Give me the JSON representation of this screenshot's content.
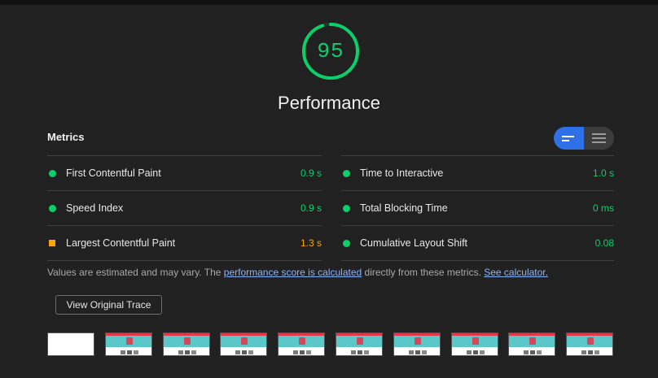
{
  "score": {
    "value": "95",
    "label": "Performance",
    "color": "#0cce6b",
    "fraction": 0.95
  },
  "metrics": {
    "title": "Metrics",
    "left": [
      {
        "name": "First Contentful Paint",
        "value": "0.9 s",
        "status": "pass"
      },
      {
        "name": "Speed Index",
        "value": "0.9 s",
        "status": "pass"
      },
      {
        "name": "Largest Contentful Paint",
        "value": "1.3 s",
        "status": "average"
      }
    ],
    "right": [
      {
        "name": "Time to Interactive",
        "value": "1.0 s",
        "status": "pass"
      },
      {
        "name": "Total Blocking Time",
        "value": "0 ms",
        "status": "pass"
      },
      {
        "name": "Cumulative Layout Shift",
        "value": "0.08",
        "status": "pass"
      }
    ],
    "toggle": {
      "active": "summary-view",
      "icons": [
        "compact-list-icon",
        "expanded-list-icon"
      ]
    }
  },
  "note": {
    "prefix": "Values are estimated and may vary. The ",
    "link1": "performance score is calculated",
    "middle": " directly from these metrics. ",
    "link2": "See calculator."
  },
  "trace_button": "View Original Trace",
  "filmstrip": {
    "frames": 10,
    "first_blank": true
  },
  "colors": {
    "pass": "#0cce6b",
    "average": "#ffa400",
    "accent": "#2f6fe8",
    "background": "#212121"
  }
}
